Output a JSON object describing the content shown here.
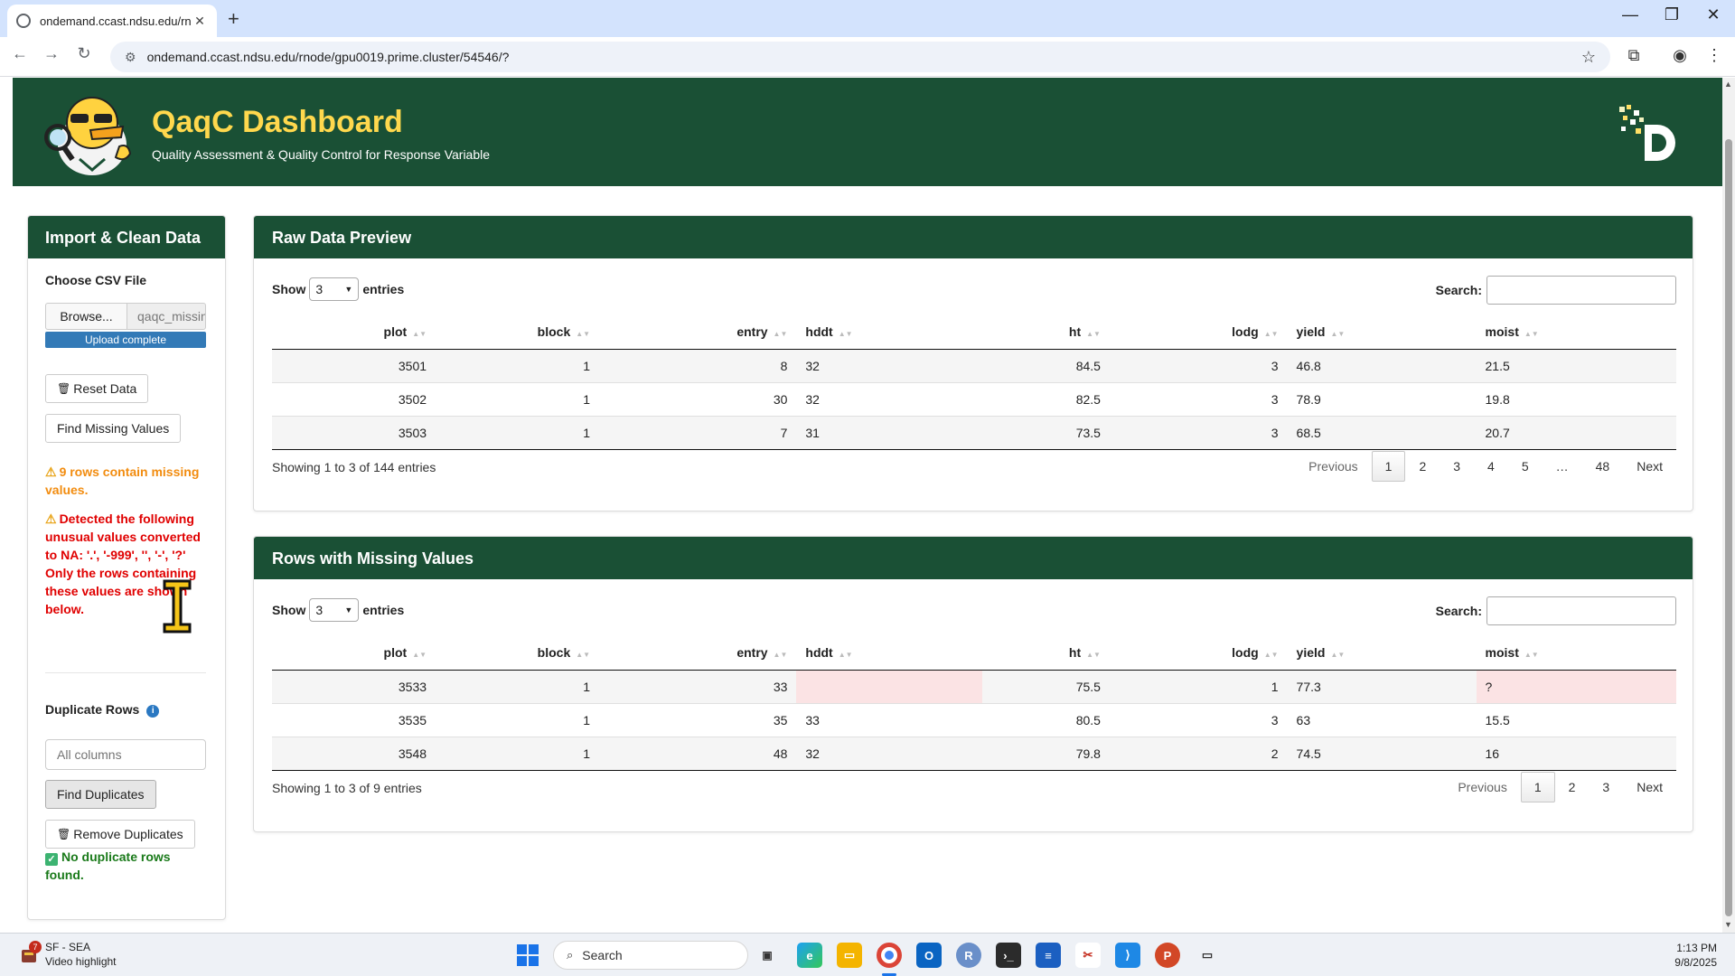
{
  "browser": {
    "tab_title": "ondemand.ccast.ndsu.edu/rnod",
    "url": "ondemand.ccast.ndsu.edu/rnode/gpu0019.prime.cluster/54546/?"
  },
  "header": {
    "title": "QaqC Dashboard",
    "subtitle": "Quality Assessment & Quality Control for Response Variable"
  },
  "sidebar": {
    "title": "Import & Clean Data",
    "choose_label": "Choose CSV File",
    "browse_label": "Browse...",
    "file_name": "qaqc_missing.csv",
    "upload_status": "Upload complete",
    "reset_label": "Reset Data",
    "find_missing_label": "Find Missing Values",
    "missing_warning": "9 rows contain missing values.",
    "unusual_warning": "Detected the following unusual values converted to NA: '.', '-999', '', '-', '?'",
    "only_rows_note": "Only the rows containing these values are shown below.",
    "duplicate_title": "Duplicate Rows",
    "columns_placeholder": "All columns",
    "find_duplicates_label": "Find Duplicates",
    "remove_duplicates_label": "Remove Duplicates",
    "duplicate_status": "No duplicate rows found."
  },
  "raw_preview": {
    "title": "Raw Data Preview",
    "show_label": "Show",
    "length_value": "3",
    "entries_label": "entries",
    "search_label": "Search:",
    "columns": [
      "plot",
      "block",
      "entry",
      "hddt",
      "ht",
      "lodg",
      "yield",
      "moist"
    ],
    "rows": [
      [
        "3501",
        "1",
        "8",
        "32",
        "84.5",
        "3",
        "46.8",
        "21.5"
      ],
      [
        "3502",
        "1",
        "30",
        "32",
        "82.5",
        "3",
        "78.9",
        "19.8"
      ],
      [
        "3503",
        "1",
        "7",
        "31",
        "73.5",
        "3",
        "68.5",
        "20.7"
      ]
    ],
    "info": "Showing 1 to 3 of 144 entries",
    "pagination": {
      "previous": "Previous",
      "pages": [
        "1",
        "2",
        "3",
        "4",
        "5",
        "…",
        "48"
      ],
      "next": "Next",
      "current": "1"
    }
  },
  "missing_rows": {
    "title": "Rows with Missing Values",
    "show_label": "Show",
    "length_value": "3",
    "entries_label": "entries",
    "search_label": "Search:",
    "columns": [
      "plot",
      "block",
      "entry",
      "hddt",
      "ht",
      "lodg",
      "yield",
      "moist"
    ],
    "rows": [
      [
        "3533",
        "1",
        "33",
        "",
        "75.5",
        "1",
        "77.3",
        "?"
      ],
      [
        "3535",
        "1",
        "35",
        "33",
        "80.5",
        "3",
        "63",
        "15.5"
      ],
      [
        "3548",
        "1",
        "48",
        "32",
        "79.8",
        "2",
        "74.5",
        "16"
      ]
    ],
    "highlighted_cells": [
      [
        0,
        3
      ],
      [
        0,
        7
      ]
    ],
    "info": "Showing 1 to 3 of 9 entries",
    "pagination": {
      "previous": "Previous",
      "pages": [
        "1",
        "2",
        "3"
      ],
      "next": "Next",
      "current": "1"
    }
  },
  "taskbar": {
    "weather_badge": "7",
    "weather_title": "SF - SEA",
    "weather_sub": "Video highlight",
    "search_placeholder": "Search",
    "time": "1:13 PM",
    "date": "9/8/2025"
  },
  "colors": {
    "header_green": "#1a5035",
    "title_yellow": "#ffd84d",
    "warning_orange": "#f28c0f",
    "warning_red": "#e00000",
    "success_green": "#1a7a1a",
    "missing_cell": "#fbe3e4",
    "progress_blue": "#337ab7"
  },
  "icons": [
    "tab-favicon",
    "close-tab-icon",
    "new-tab-icon",
    "minimize-icon",
    "restore-icon",
    "close-window-icon",
    "back-icon",
    "forward-icon",
    "reload-icon",
    "site-info-icon",
    "bookmark-star-icon",
    "tab-search-icon",
    "profile-icon",
    "menu-icon",
    "trash-icon",
    "warning-icon",
    "info-icon",
    "checkbox-icon",
    "windows-start-icon",
    "search-icon"
  ]
}
